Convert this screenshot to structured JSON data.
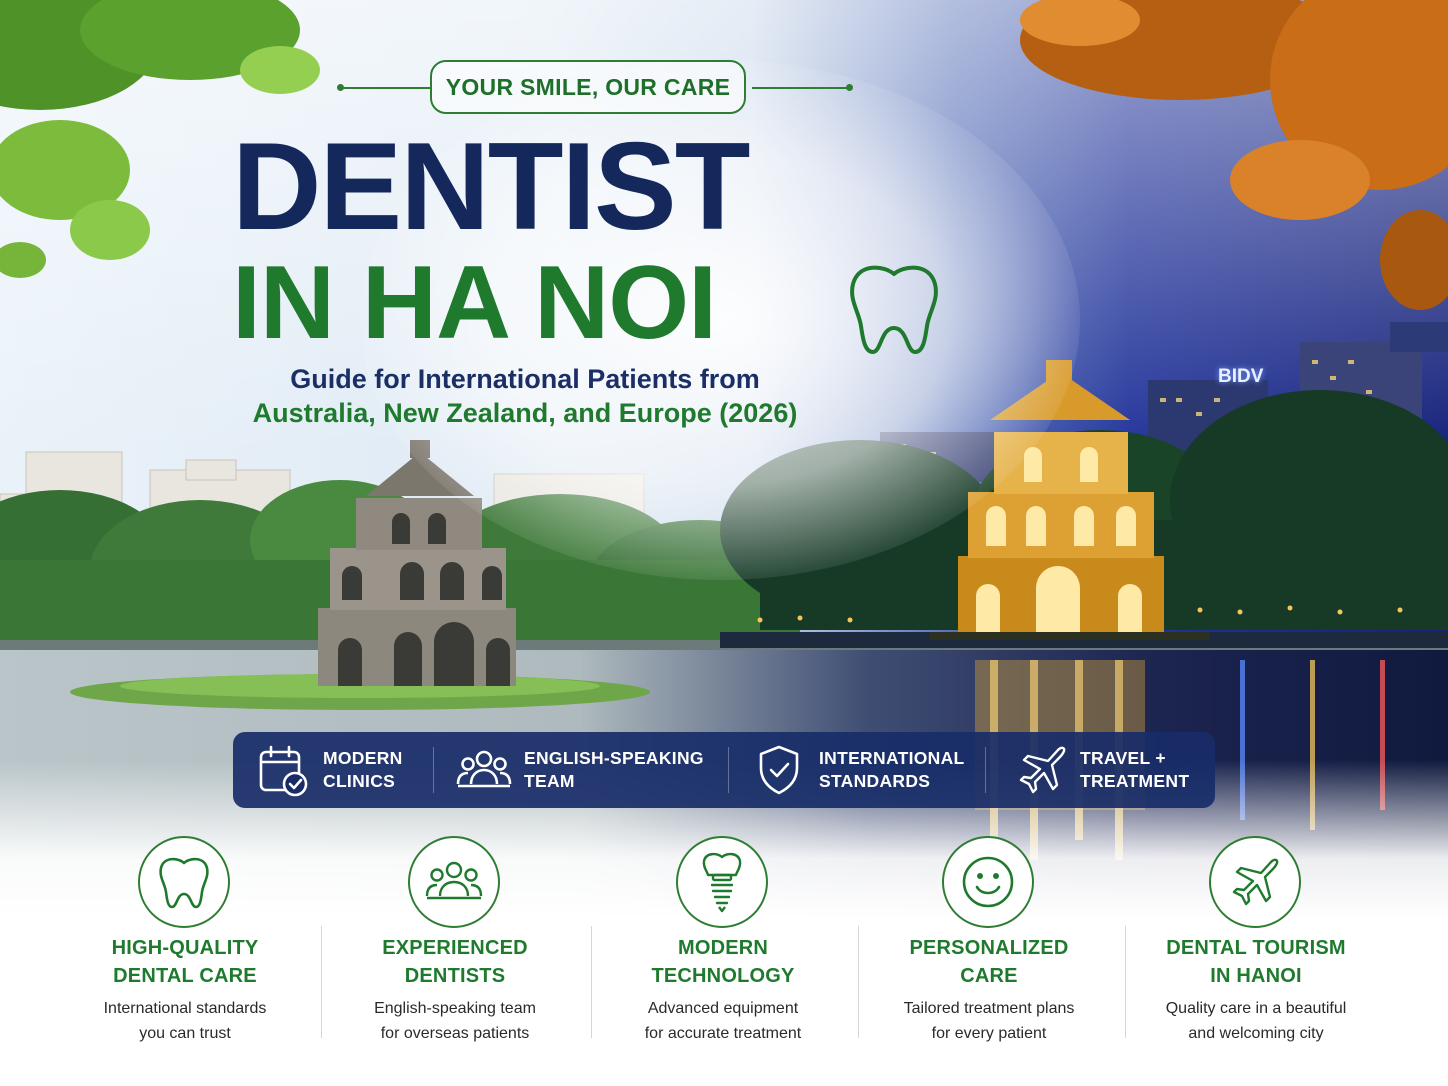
{
  "header": {
    "tagline": "YOUR SMILE, OUR CARE",
    "title_line1": "DENTIST",
    "title_line2": "IN HA NOI",
    "subtitle_line1": "Guide for International Patients from",
    "subtitle_line2": "Australia, New Zealand, and Europe (2026)"
  },
  "scene": {
    "bank_sign": "BIDV"
  },
  "feature_bar": [
    {
      "icon": "calendar-check-icon",
      "line1": "MODERN",
      "line2": "CLINICS"
    },
    {
      "icon": "team-icon",
      "line1": "ENGLISH-SPEAKING",
      "line2": "TEAM"
    },
    {
      "icon": "shield-check-icon",
      "line1": "INTERNATIONAL",
      "line2": "STANDARDS"
    },
    {
      "icon": "airplane-icon",
      "line1": "TRAVEL +",
      "line2": "TREATMENT"
    }
  ],
  "features": [
    {
      "icon": "tooth-icon",
      "title_line1": "HIGH-QUALITY",
      "title_line2": "DENTAL CARE",
      "desc_line1": "International standards",
      "desc_line2": "you can trust"
    },
    {
      "icon": "team-icon",
      "title_line1": "EXPERIENCED",
      "title_line2": "DENTISTS",
      "desc_line1": "English-speaking team",
      "desc_line2": "for overseas patients"
    },
    {
      "icon": "dental-implant-icon",
      "title_line1": "MODERN",
      "title_line2": "TECHNOLOGY",
      "desc_line1": "Advanced equipment",
      "desc_line2": "for accurate treatment"
    },
    {
      "icon": "smiley-icon",
      "title_line1": "PERSONALIZED",
      "title_line2": "CARE",
      "desc_line1": "Tailored treatment plans",
      "desc_line2": "for every patient"
    },
    {
      "icon": "airplane-icon",
      "title_line1": "DENTAL TOURISM",
      "title_line2": "IN HANOI",
      "desc_line1": "Quality care in a beautiful",
      "desc_line2": "and welcoming city"
    }
  ],
  "colors": {
    "navy": "#14285c",
    "green": "#1f7a2e",
    "bar": "#182c68"
  }
}
